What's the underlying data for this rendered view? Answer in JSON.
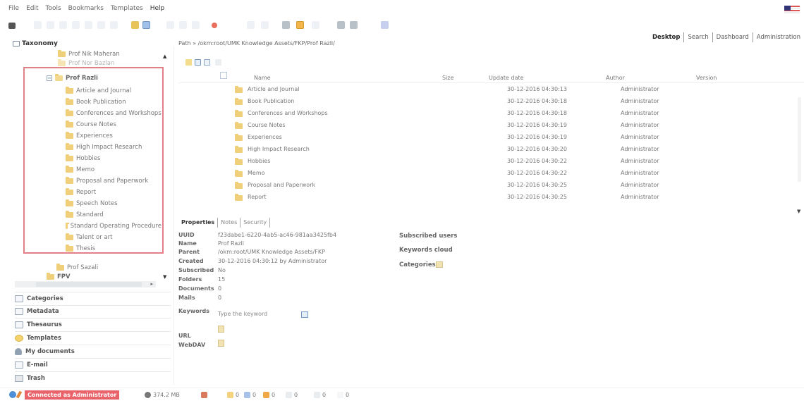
{
  "menu": [
    "File",
    "Edit",
    "Tools",
    "Bookmarks",
    "Templates",
    "Help"
  ],
  "tabs": [
    "Desktop",
    "Search",
    "Dashboard",
    "Administration"
  ],
  "left": {
    "taxonomy_title": "Taxonomy",
    "tree": {
      "above": [
        "Prof Nik Maheran",
        "Prof Nor Bazlan"
      ],
      "selected_parent": "Prof Razli",
      "children": [
        "Article and Journal",
        "Book Publication",
        "Conferences and Workshops",
        "Course Notes",
        "Experiences",
        "High Impact Research",
        "Hobbies",
        "Memo",
        "Proposal and Paperwork",
        "Report",
        "Speech Notes",
        "Standard",
        "Standard Operating Procedure",
        "Talent or art",
        "Thesis"
      ],
      "below": [
        "Prof Sazali",
        "FPV"
      ]
    },
    "accordion": [
      "Categories",
      "Metadata",
      "Thesaurus",
      "Templates",
      "My documents",
      "E-mail",
      "Trash"
    ]
  },
  "path": {
    "label": "Path",
    "value": "/okm:root/UMK Knowledge Assets/FKP/Prof Razli/"
  },
  "grid": {
    "columns": {
      "name": "Name",
      "size": "Size",
      "update": "Update date",
      "author": "Author",
      "version": "Version"
    },
    "rows": [
      {
        "name": "Article and Journal",
        "date": "30-12-2016 04:30:13",
        "author": "Administrator"
      },
      {
        "name": "Book Publication",
        "date": "30-12-2016 04:30:18",
        "author": "Administrator"
      },
      {
        "name": "Conferences and Workshops",
        "date": "30-12-2016 04:30:18",
        "author": "Administrator"
      },
      {
        "name": "Course Notes",
        "date": "30-12-2016 04:30:19",
        "author": "Administrator"
      },
      {
        "name": "Experiences",
        "date": "30-12-2016 04:30:19",
        "author": "Administrator"
      },
      {
        "name": "High Impact Research",
        "date": "30-12-2016 04:30:20",
        "author": "Administrator"
      },
      {
        "name": "Hobbies",
        "date": "30-12-2016 04:30:22",
        "author": "Administrator"
      },
      {
        "name": "Memo",
        "date": "30-12-2016 04:30:22",
        "author": "Administrator"
      },
      {
        "name": "Proposal and Paperwork",
        "date": "30-12-2016 04:30:25",
        "author": "Administrator"
      },
      {
        "name": "Report",
        "date": "30-12-2016 04:30:25",
        "author": "Administrator"
      }
    ]
  },
  "properties": {
    "tabs": [
      "Properties",
      "Notes",
      "Security"
    ],
    "uuid_label": "UUID",
    "uuid": "f23dabe1-6220-4ab5-ac46-981aa3425fb4",
    "name_label": "Name",
    "name": "Prof Razli",
    "parent_label": "Parent",
    "parent": "/okm:root/UMK Knowledge Assets/FKP",
    "created_label": "Created",
    "created": "30-12-2016 04:30:12 by Administrator",
    "subscribed_label": "Subscribed",
    "subscribed": "No",
    "folders_label": "Folders",
    "folders": "15",
    "documents_label": "Documents",
    "documents": "0",
    "mails_label": "Mails",
    "mails": "0",
    "keywords_label": "Keywords",
    "keyword_placeholder": "Type the keyword",
    "url_label": "URL",
    "webdav_label": "WebDAV",
    "subscribed_users": "Subscribed users",
    "keywords_cloud": "Keywords cloud",
    "categories": "Categories"
  },
  "status": {
    "connected": "Connected as Administrator",
    "memory": "374.2 MB",
    "counts": [
      "0",
      "0",
      "0",
      "0",
      "0",
      "0"
    ]
  }
}
